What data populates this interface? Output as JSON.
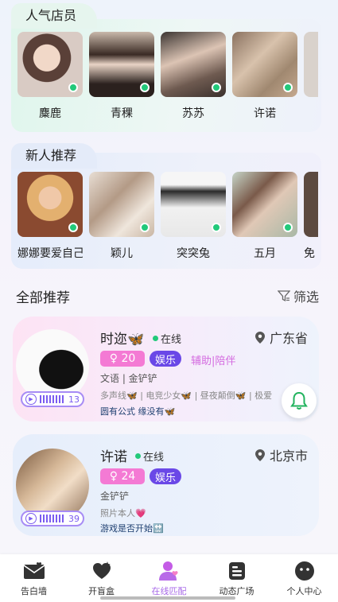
{
  "hot_section": {
    "title": "人气店员",
    "people": [
      {
        "name": "麋鹿"
      },
      {
        "name": "青稞"
      },
      {
        "name": "苏苏"
      },
      {
        "name": "许诺"
      }
    ]
  },
  "new_section": {
    "title": "新人推荐",
    "people": [
      {
        "name": "娜娜要爱自己"
      },
      {
        "name": "颖儿"
      },
      {
        "name": "突突兔"
      },
      {
        "name": "五月"
      },
      {
        "name": "免"
      }
    ]
  },
  "all": {
    "title": "全部推荐",
    "filter_label": "筛选"
  },
  "cards": [
    {
      "name": "时迩🦋",
      "online": "在线",
      "city": "广东省",
      "age": "♀ 20",
      "tag": "娱乐",
      "roles": "辅助|陪伴",
      "tier": "文语 | 金铲铲",
      "skills": "多声线🦋 | 电竞少女🦋 | 昼夜颠倒🦋 | 极爱",
      "motto": "圆有公式 缘没有🦋",
      "voice_seconds": "13"
    },
    {
      "name": "许诺",
      "online": "在线",
      "city": "北京市",
      "age": "♀ 24",
      "tag": "娱乐",
      "tier": "金铲铲",
      "skills": "照片本人💗",
      "motto": "游戏是否开始🔛",
      "voice_seconds": "39"
    }
  ],
  "nav": [
    {
      "label": "告白墙",
      "icon": "confession-wall-icon"
    },
    {
      "label": "开盲盒",
      "icon": "blind-box-icon"
    },
    {
      "label": "在线匹配",
      "icon": "match-icon",
      "active": true
    },
    {
      "label": "动态广场",
      "icon": "feed-icon"
    },
    {
      "label": "个人中心",
      "icon": "profile-icon"
    }
  ],
  "colors": {
    "accent_pink": "#f47ad4",
    "accent_purple": "#6a48e7",
    "online_green": "#22c97a",
    "nav_active": "#a86ae8"
  }
}
